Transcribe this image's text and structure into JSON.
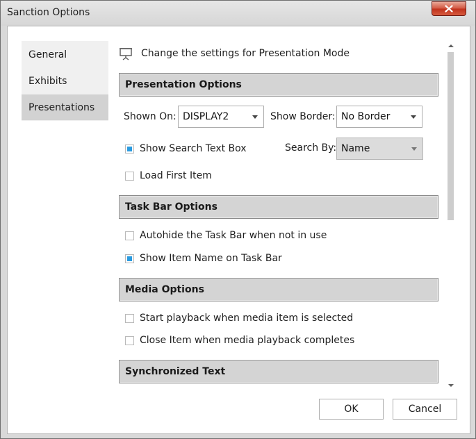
{
  "window": {
    "title": "Sanction Options"
  },
  "nav": {
    "items": [
      {
        "label": "General",
        "selected": false
      },
      {
        "label": "Exhibits",
        "selected": false
      },
      {
        "label": "Presentations",
        "selected": true
      }
    ]
  },
  "header": {
    "icon": "presentation-screen-icon",
    "text": "Change the settings for Presentation Mode"
  },
  "presentation_options": {
    "title": "Presentation Options",
    "shown_on_label": "Shown On:",
    "shown_on_value": "DISPLAY2",
    "show_border_label": "Show Border:",
    "show_border_value": "No Border",
    "show_search_text_box": {
      "label": "Show Search Text Box",
      "checked": true
    },
    "search_by_label": "Search By:",
    "search_by_value": "Name",
    "load_first_item": {
      "label": "Load First Item",
      "checked": false
    }
  },
  "task_bar_options": {
    "title": "Task Bar Options",
    "autohide": {
      "label": "Autohide the Task Bar when not in use",
      "checked": false
    },
    "show_item_name": {
      "label": "Show Item Name on Task Bar",
      "checked": true
    }
  },
  "media_options": {
    "title": "Media Options",
    "start_playback": {
      "label": "Start playback when media item is selected",
      "checked": false
    },
    "close_item": {
      "label": "Close Item when media playback completes",
      "checked": false
    }
  },
  "synchronized_text": {
    "title": "Synchronized Text"
  },
  "buttons": {
    "ok": "OK",
    "cancel": "Cancel"
  },
  "colors": {
    "accent_check": "#2a9be0",
    "close_button": "#c9442e",
    "selected_nav": "#d2d2d2",
    "section_header": "#d4d4d4"
  }
}
